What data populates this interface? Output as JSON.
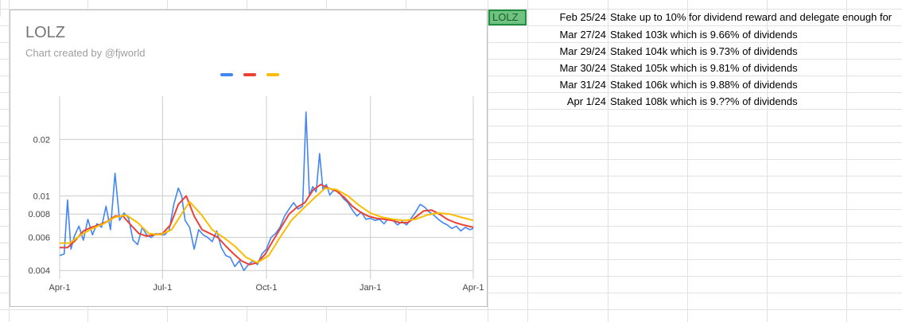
{
  "ticker": "LOLZ",
  "notes": [
    {
      "date": "Feb 25/24",
      "text": "Stake up to 10% for dividend reward and delegate enough for"
    },
    {
      "date": "Mar 27/24",
      "text": "Staked 103k which is 9.66% of dividends"
    },
    {
      "date": "Mar 29/24",
      "text": "Staked 104k which is 9.73% of dividends"
    },
    {
      "date": "Mar 30/24",
      "text": "Staked 105k which is 9.81% of dividends"
    },
    {
      "date": "Mar 31/24",
      "text": "Staked 106k which is 9.88% of dividends"
    },
    {
      "date": "Apr 1/24",
      "text": "Staked 108k which is 9.??% of dividends"
    }
  ],
  "chart_data": {
    "type": "line",
    "title": "LOLZ",
    "subtitle": "Chart created by @fjworld",
    "xlabel": "",
    "ylabel": "",
    "y_scale": "log",
    "ylim": [
      0.0036,
      0.034
    ],
    "x_ticks": [
      "Apr-1",
      "Jul-1",
      "Oct-1",
      "Jan-1",
      "Apr-1"
    ],
    "x_tick_dates": [
      "2023-04-01",
      "2023-07-01",
      "2023-10-01",
      "2024-01-01",
      "2024-04-01"
    ],
    "y_ticks": [
      0.004,
      0.006,
      0.008,
      0.01,
      0.02
    ],
    "y_tick_labels": [
      "0.004",
      "0.006",
      "0.008",
      "0.01",
      "0.02"
    ],
    "grid": true,
    "legend_position": "top",
    "series": [
      {
        "color": "#4285f4",
        "points": [
          [
            "2023-04-01",
            0.0048
          ],
          [
            "2023-04-05",
            0.0049
          ],
          [
            "2023-04-08",
            0.0095
          ],
          [
            "2023-04-11",
            0.0052
          ],
          [
            "2023-04-14",
            0.0061
          ],
          [
            "2023-04-18",
            0.0069
          ],
          [
            "2023-04-22",
            0.0058
          ],
          [
            "2023-04-26",
            0.0075
          ],
          [
            "2023-04-30",
            0.0062
          ],
          [
            "2023-05-04",
            0.0071
          ],
          [
            "2023-05-08",
            0.0068
          ],
          [
            "2023-05-12",
            0.0088
          ],
          [
            "2023-05-16",
            0.0066
          ],
          [
            "2023-05-20",
            0.0132
          ],
          [
            "2023-05-24",
            0.0074
          ],
          [
            "2023-05-28",
            0.0081
          ],
          [
            "2023-06-01",
            0.0076
          ],
          [
            "2023-06-05",
            0.0058
          ],
          [
            "2023-06-09",
            0.0055
          ],
          [
            "2023-06-13",
            0.0068
          ],
          [
            "2023-06-17",
            0.0062
          ],
          [
            "2023-06-21",
            0.006
          ],
          [
            "2023-06-25",
            0.0063
          ],
          [
            "2023-06-29",
            0.0062
          ],
          [
            "2023-07-03",
            0.0062
          ],
          [
            "2023-07-07",
            0.0066
          ],
          [
            "2023-07-11",
            0.009
          ],
          [
            "2023-07-15",
            0.011
          ],
          [
            "2023-07-18",
            0.01
          ],
          [
            "2023-07-21",
            0.0074
          ],
          [
            "2023-07-25",
            0.0068
          ],
          [
            "2023-07-29",
            0.0052
          ],
          [
            "2023-08-02",
            0.0066
          ],
          [
            "2023-08-06",
            0.0062
          ],
          [
            "2023-08-10",
            0.006
          ],
          [
            "2023-08-14",
            0.0057
          ],
          [
            "2023-08-18",
            0.0065
          ],
          [
            "2023-08-22",
            0.0053
          ],
          [
            "2023-08-26",
            0.0048
          ],
          [
            "2023-08-30",
            0.0047
          ],
          [
            "2023-09-03",
            0.0042
          ],
          [
            "2023-09-07",
            0.0045
          ],
          [
            "2023-09-11",
            0.004
          ],
          [
            "2023-09-15",
            0.0043
          ],
          [
            "2023-09-19",
            0.0045
          ],
          [
            "2023-09-23",
            0.0043
          ],
          [
            "2023-09-27",
            0.0049
          ],
          [
            "2023-10-01",
            0.0052
          ],
          [
            "2023-10-05",
            0.006
          ],
          [
            "2023-10-09",
            0.0063
          ],
          [
            "2023-10-13",
            0.0068
          ],
          [
            "2023-10-17",
            0.0078
          ],
          [
            "2023-10-21",
            0.0085
          ],
          [
            "2023-10-25",
            0.0092
          ],
          [
            "2023-10-29",
            0.0085
          ],
          [
            "2023-11-02",
            0.0088
          ],
          [
            "2023-11-05",
            0.028
          ],
          [
            "2023-11-08",
            0.01
          ],
          [
            "2023-11-11",
            0.0112
          ],
          [
            "2023-11-14",
            0.0105
          ],
          [
            "2023-11-17",
            0.0168
          ],
          [
            "2023-11-20",
            0.0108
          ],
          [
            "2023-11-23",
            0.0115
          ],
          [
            "2023-11-26",
            0.0101
          ],
          [
            "2023-11-30",
            0.0108
          ],
          [
            "2023-12-04",
            0.0105
          ],
          [
            "2023-12-08",
            0.0097
          ],
          [
            "2023-12-12",
            0.0092
          ],
          [
            "2023-12-16",
            0.0084
          ],
          [
            "2023-12-20",
            0.0078
          ],
          [
            "2023-12-24",
            0.0082
          ],
          [
            "2023-12-28",
            0.0075
          ],
          [
            "2024-01-01",
            0.0076
          ],
          [
            "2024-01-05",
            0.0074
          ],
          [
            "2024-01-09",
            0.0075
          ],
          [
            "2024-01-13",
            0.0071
          ],
          [
            "2024-01-17",
            0.0076
          ],
          [
            "2024-01-21",
            0.0074
          ],
          [
            "2024-01-25",
            0.007
          ],
          [
            "2024-01-29",
            0.0073
          ],
          [
            "2024-02-02",
            0.007
          ],
          [
            "2024-02-06",
            0.0076
          ],
          [
            "2024-02-10",
            0.0082
          ],
          [
            "2024-02-14",
            0.009
          ],
          [
            "2024-02-18",
            0.0087
          ],
          [
            "2024-02-22",
            0.0082
          ],
          [
            "2024-02-26",
            0.0079
          ],
          [
            "2024-03-01",
            0.0075
          ],
          [
            "2024-03-05",
            0.0072
          ],
          [
            "2024-03-09",
            0.007
          ],
          [
            "2024-03-13",
            0.0067
          ],
          [
            "2024-03-17",
            0.0069
          ],
          [
            "2024-03-21",
            0.0065
          ],
          [
            "2024-03-25",
            0.0068
          ],
          [
            "2024-03-29",
            0.0066
          ],
          [
            "2024-04-01",
            0.0067
          ]
        ]
      },
      {
        "color": "#ea4335",
        "points": [
          [
            "2023-04-01",
            0.0053
          ],
          [
            "2023-04-08",
            0.0053
          ],
          [
            "2023-04-15",
            0.0058
          ],
          [
            "2023-04-22",
            0.0065
          ],
          [
            "2023-04-29",
            0.0068
          ],
          [
            "2023-05-06",
            0.007
          ],
          [
            "2023-05-13",
            0.0073
          ],
          [
            "2023-05-20",
            0.0078
          ],
          [
            "2023-05-27",
            0.0078
          ],
          [
            "2023-06-03",
            0.007
          ],
          [
            "2023-06-10",
            0.0063
          ],
          [
            "2023-06-17",
            0.0061
          ],
          [
            "2023-06-24",
            0.0062
          ],
          [
            "2023-07-01",
            0.0063
          ],
          [
            "2023-07-08",
            0.007
          ],
          [
            "2023-07-15",
            0.009
          ],
          [
            "2023-07-22",
            0.01
          ],
          [
            "2023-07-29",
            0.0078
          ],
          [
            "2023-08-05",
            0.0066
          ],
          [
            "2023-08-12",
            0.0063
          ],
          [
            "2023-08-19",
            0.006
          ],
          [
            "2023-08-26",
            0.0054
          ],
          [
            "2023-09-02",
            0.0049
          ],
          [
            "2023-09-09",
            0.0045
          ],
          [
            "2023-09-16",
            0.0043
          ],
          [
            "2023-09-23",
            0.0044
          ],
          [
            "2023-09-30",
            0.0049
          ],
          [
            "2023-10-07",
            0.0058
          ],
          [
            "2023-10-14",
            0.0068
          ],
          [
            "2023-10-21",
            0.008
          ],
          [
            "2023-10-28",
            0.0087
          ],
          [
            "2023-11-04",
            0.0092
          ],
          [
            "2023-11-11",
            0.0107
          ],
          [
            "2023-11-18",
            0.0115
          ],
          [
            "2023-11-25",
            0.011
          ],
          [
            "2023-12-02",
            0.0106
          ],
          [
            "2023-12-09",
            0.0098
          ],
          [
            "2023-12-16",
            0.0088
          ],
          [
            "2023-12-23",
            0.0082
          ],
          [
            "2023-12-30",
            0.0078
          ],
          [
            "2024-01-06",
            0.0076
          ],
          [
            "2024-01-13",
            0.0075
          ],
          [
            "2024-01-20",
            0.0074
          ],
          [
            "2024-01-27",
            0.0072
          ],
          [
            "2024-02-03",
            0.0072
          ],
          [
            "2024-02-10",
            0.0077
          ],
          [
            "2024-02-17",
            0.0083
          ],
          [
            "2024-02-24",
            0.0084
          ],
          [
            "2024-03-02",
            0.008
          ],
          [
            "2024-03-09",
            0.0075
          ],
          [
            "2024-03-16",
            0.0072
          ],
          [
            "2024-03-23",
            0.007
          ],
          [
            "2024-04-01",
            0.0068
          ]
        ]
      },
      {
        "color": "#fbbc04",
        "points": [
          [
            "2023-04-01",
            0.0056
          ],
          [
            "2023-04-10",
            0.0056
          ],
          [
            "2023-04-20",
            0.0062
          ],
          [
            "2023-04-30",
            0.0067
          ],
          [
            "2023-05-10",
            0.0071
          ],
          [
            "2023-05-20",
            0.0077
          ],
          [
            "2023-05-30",
            0.0079
          ],
          [
            "2023-06-09",
            0.0072
          ],
          [
            "2023-06-19",
            0.0063
          ],
          [
            "2023-06-29",
            0.0062
          ],
          [
            "2023-07-09",
            0.0066
          ],
          [
            "2023-07-19",
            0.0082
          ],
          [
            "2023-07-25",
            0.0093
          ],
          [
            "2023-08-04",
            0.008
          ],
          [
            "2023-08-14",
            0.0066
          ],
          [
            "2023-08-24",
            0.006
          ],
          [
            "2023-09-03",
            0.0054
          ],
          [
            "2023-09-13",
            0.0047
          ],
          [
            "2023-09-23",
            0.0044
          ],
          [
            "2023-10-03",
            0.0048
          ],
          [
            "2023-10-13",
            0.006
          ],
          [
            "2023-10-23",
            0.0074
          ],
          [
            "2023-11-02",
            0.0085
          ],
          [
            "2023-11-12",
            0.0097
          ],
          [
            "2023-11-22",
            0.011
          ],
          [
            "2023-12-02",
            0.0108
          ],
          [
            "2023-12-12",
            0.01
          ],
          [
            "2023-12-22",
            0.0089
          ],
          [
            "2024-01-01",
            0.0081
          ],
          [
            "2024-01-11",
            0.0077
          ],
          [
            "2024-01-21",
            0.0075
          ],
          [
            "2024-01-31",
            0.0074
          ],
          [
            "2024-02-10",
            0.0075
          ],
          [
            "2024-02-20",
            0.0079
          ],
          [
            "2024-03-01",
            0.0081
          ],
          [
            "2024-03-11",
            0.008
          ],
          [
            "2024-03-21",
            0.0077
          ],
          [
            "2024-04-01",
            0.0074
          ]
        ]
      }
    ]
  }
}
